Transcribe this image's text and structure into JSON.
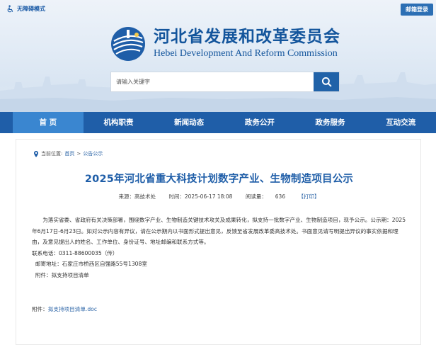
{
  "topbar": {
    "accessibility_label": "无障碍模式",
    "mail_label": "邮箱登录"
  },
  "logo": {
    "title_cn": "河北省发展和改革委员会",
    "title_en": "Hebei Development And Reform Commission"
  },
  "search": {
    "placeholder": "请输入关键字"
  },
  "nav": {
    "items": [
      {
        "label": "首  页"
      },
      {
        "label": "机构职责"
      },
      {
        "label": "新闻动态"
      },
      {
        "label": "政务公开"
      },
      {
        "label": "政务服务"
      },
      {
        "label": "互动交流"
      }
    ]
  },
  "breadcrumb": {
    "prefix": "当前位置:",
    "home": "首页",
    "sep": ">",
    "current": "公告公示"
  },
  "article": {
    "title": "2025年河北省重大科技计划数字产业、生物制造项目公示",
    "source": "来源：高技术处",
    "time": "时间：2025-06-17 18:08",
    "views": "阅读量：     636",
    "print": "【打印】",
    "para1": "为落实省委、省政府有关决策部署，围绕数字产业、生物制造关键技术攻关及成果转化，拟支持一批数字产业、生物制造项目，现予公示。公示期：2025年6月17日-6月23日。如对公示内容有异议，请在公示期内以书面形式提出意见，反馈至省发展改革委高技术处。书面意见请写明提出异议的事实依据和理由，及意见提出人的姓名、工作单位、身份证号、地址邮编和联系方式等。",
    "contact": "联系电话：0311-88600035（传）",
    "address": "  邮寄地址：石家庄市桥西区自强路55号1308室",
    "appendix": "  附件：拟支持项目清单",
    "attachment_label": "附件：",
    "attachment_file": "拟支持项目清单.doc"
  },
  "colors": {
    "brand_blue": "#1f5ea8",
    "nav_active": "#3a86d0",
    "link": "#2a63a6"
  }
}
